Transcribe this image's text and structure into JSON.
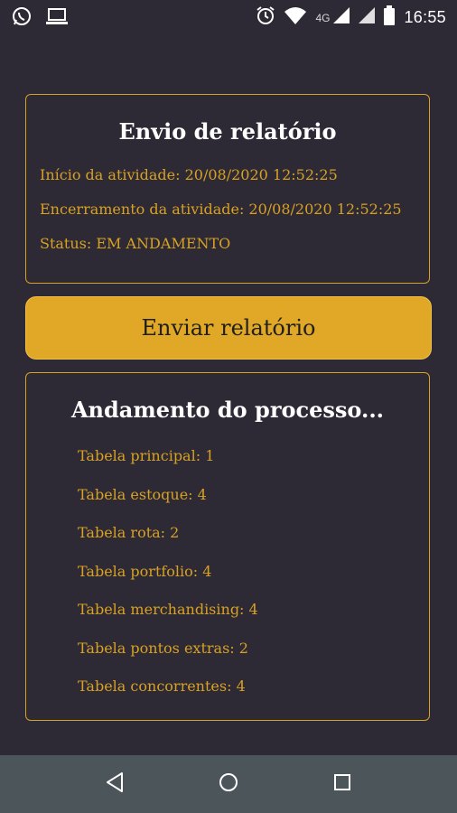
{
  "status_bar": {
    "time": "16:55",
    "network": "4G",
    "icons": [
      "whatsapp-icon",
      "laptop-icon",
      "alarm-icon",
      "wifi-icon",
      "signal-icon",
      "signal-icon",
      "battery-icon"
    ]
  },
  "report_card": {
    "title": "Envio de relatório",
    "start_line": "Início da atividade: 20/08/2020 12:52:25",
    "end_line": "Encerramento da atividade: 20/08/2020 12:52:25",
    "status_line": "Status: EM ANDAMENTO"
  },
  "send_button": {
    "label": "Enviar relatório"
  },
  "progress_card": {
    "title": "Andamento do processo...",
    "items": [
      "Tabela principal: 1",
      "Tabela estoque: 4",
      "Tabela rota: 2",
      "Tabela portfolio: 4",
      "Tabela merchandising: 4",
      "Tabela pontos extras: 2",
      "Tabela concorrentes: 4"
    ]
  },
  "nav_bar": {
    "icons": [
      "back-icon",
      "home-icon",
      "recent-apps-icon"
    ]
  },
  "colors": {
    "background": "#2d2a35",
    "accent": "#d8a123",
    "button": "#e0a826",
    "nav_bar": "#4c555a"
  }
}
